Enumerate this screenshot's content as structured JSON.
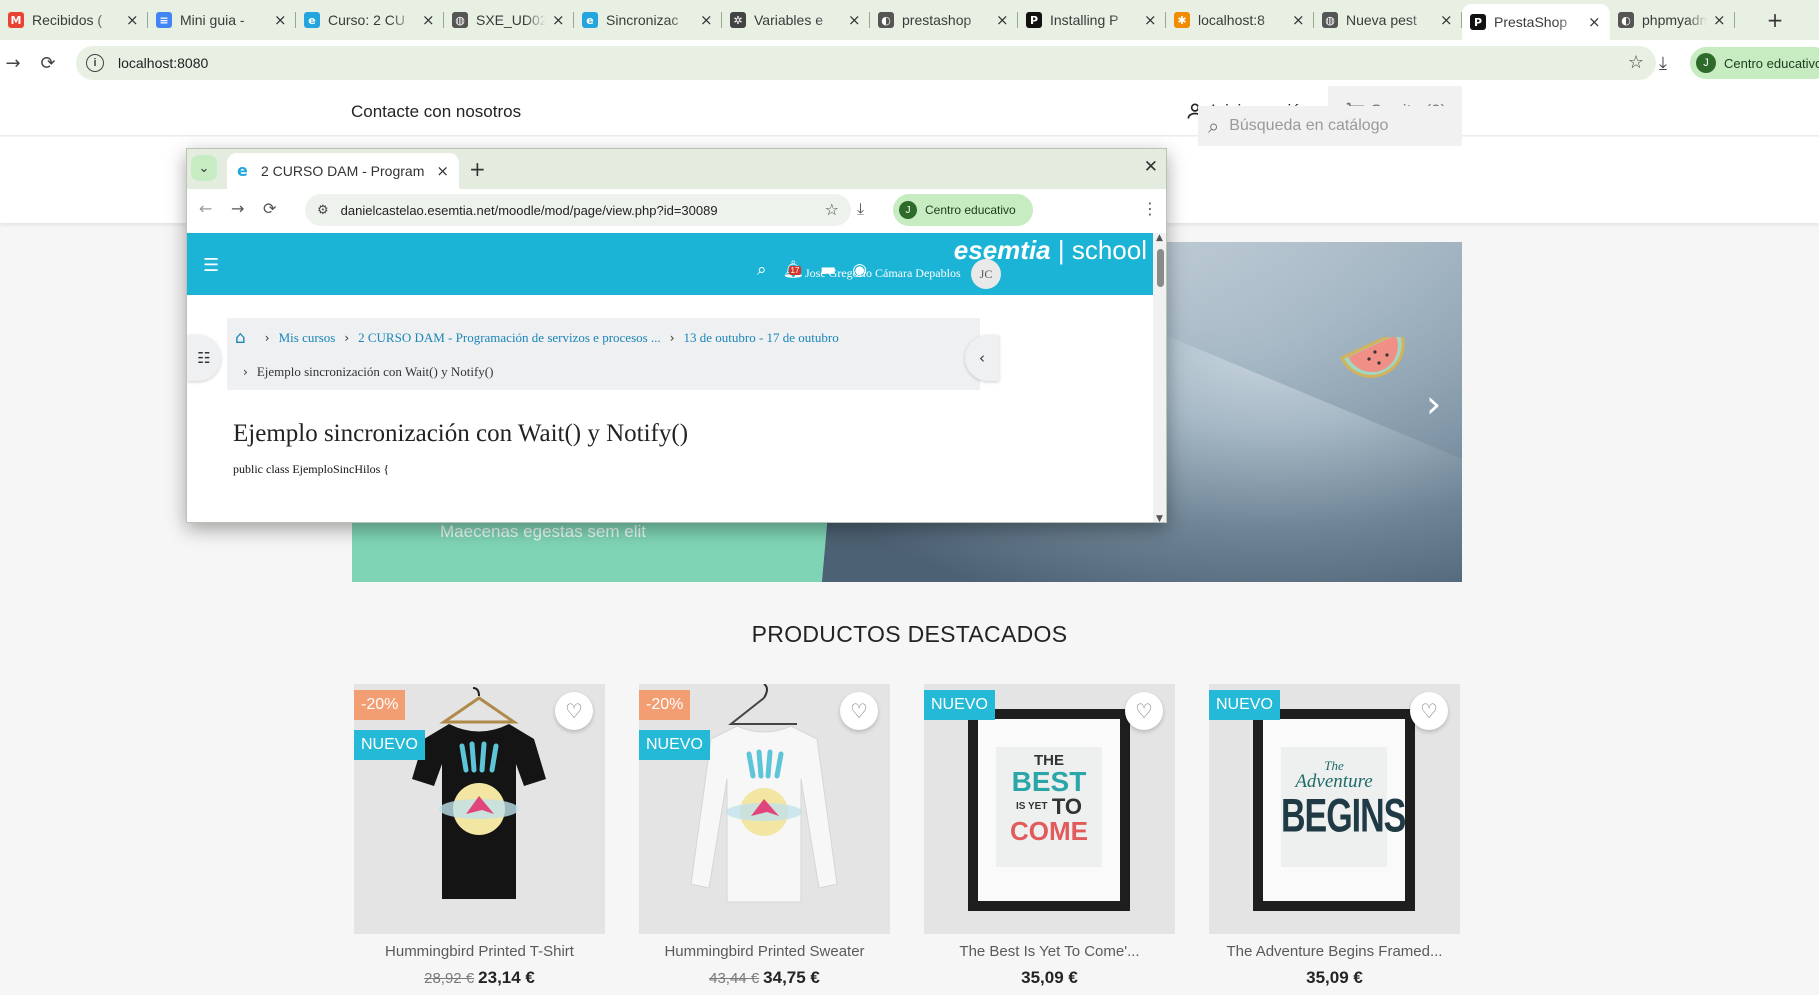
{
  "browser": {
    "tabs": [
      {
        "title": "Recibidos (",
        "icon": "gmail-icon",
        "color": "#ea4335"
      },
      {
        "title": "Mini guia - ",
        "icon": "docs-icon",
        "color": "#4285f4"
      },
      {
        "title": "Curso: 2 CU",
        "icon": "esemtia-icon",
        "color": "#23a6dd"
      },
      {
        "title": "SXE_UD02_",
        "icon": "globe-icon",
        "color": "#555555"
      },
      {
        "title": "Sincronizac",
        "icon": "esemtia-icon",
        "color": "#23a6dd"
      },
      {
        "title": "Variables e",
        "icon": "openai-icon",
        "color": "#444444"
      },
      {
        "title": "prestashop",
        "icon": "web-icon",
        "color": "#555555"
      },
      {
        "title": "Installing P",
        "icon": "prestashop-icon",
        "color": "#111111"
      },
      {
        "title": "localhost:8",
        "icon": "xampp-icon",
        "color": "#f28b00"
      },
      {
        "title": "Nueva pest",
        "icon": "chrome-icon",
        "color": "#555555"
      },
      {
        "title": "PrestaShop",
        "icon": "prestashop-icon",
        "color": "#111111"
      },
      {
        "title": "phpmyadm",
        "icon": "web-icon",
        "color": "#555555"
      }
    ],
    "url": "localhost:8080",
    "profile_label": "Centro educativo",
    "profile_initial": "J"
  },
  "shop": {
    "contact": "Contacte con nosotros",
    "login": "Iniciar sesión",
    "cart": "Carrito (0)",
    "search_placeholder": "Búsqueda en catálogo",
    "hero_sub": "Maecenas egestas sem elit",
    "section_title": "PRODUCTOS DESTACADOS",
    "products": [
      {
        "name": "Hummingbird Printed T-Shirt",
        "old_price": "28,92 €",
        "price": "23,14 €",
        "discount": "-20%",
        "new": "NUEVO"
      },
      {
        "name": "Hummingbird Printed Sweater",
        "old_price": "43,44 €",
        "price": "34,75 €",
        "discount": "-20%",
        "new": "NUEVO"
      },
      {
        "name": "The Best Is Yet To Come'...",
        "price": "35,09 €",
        "new": "NUEVO"
      },
      {
        "name": "The Adventure Begins Framed...",
        "price": "35,09 €",
        "new": "NUEVO"
      }
    ],
    "poster1": {
      "l1": "THE",
      "l2": "BEST",
      "l3": "IS YET",
      "l4": "TO",
      "l5": "COME"
    },
    "poster2": {
      "l1": "The",
      "l2": "Adventure",
      "l3": "BEGINS"
    }
  },
  "popup": {
    "tab_title": "2 CURSO DAM - Program",
    "url": "danielcastelao.esemtia.net/moodle/mod/page/view.php?id=30089",
    "profile_label": "Centro educativo",
    "profile_initial": "J",
    "brand": "esemtia",
    "brand_suffix": "school",
    "notif_count": "17",
    "user_name": "José Gregorio Cámara Depablos",
    "user_initials": "JC",
    "breadcrumb": [
      "Mis cursos",
      "2 CURSO DAM - Programación de servizos e procesos ...",
      "13 de outubro - 17 de outubro"
    ],
    "breadcrumb_current": "Ejemplo sincronización con Wait() y Notify()",
    "page_title": "Ejemplo sincronización con Wait() y Notify()",
    "code_line": "public class EjemploSincHilos {"
  },
  "colors": {
    "accent": "#24b9d7",
    "discount": "#f39d72",
    "moodle_bar": "#1bb4d6",
    "hero_green": "#7fd4b5"
  }
}
